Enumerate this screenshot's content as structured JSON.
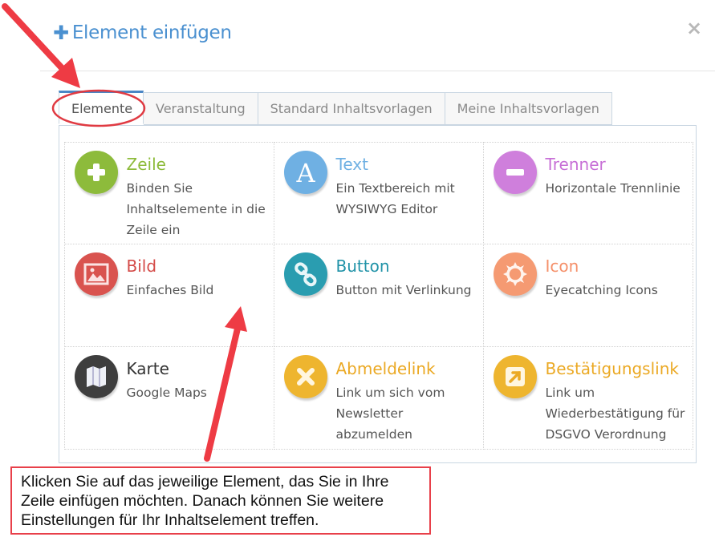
{
  "modal": {
    "title": "Element einfügen",
    "title_icon": "plus-icon",
    "close_icon": "close-icon",
    "close_label": "×"
  },
  "tabs": [
    {
      "label": "Elemente",
      "active": true
    },
    {
      "label": "Veranstaltung",
      "active": false
    },
    {
      "label": "Standard Inhaltsvorlagen",
      "active": false
    },
    {
      "label": "Meine Inhaltsvorlagen",
      "active": false
    }
  ],
  "elements": [
    {
      "title": "Zeile",
      "description": "Binden Sie Inhaltselemente in die Zeile ein",
      "icon": "plus-icon",
      "color": "#8dbb3b",
      "title_color": "#8dbb3b"
    },
    {
      "title": "Text",
      "description": "Ein Textbereich mit WYSIWYG Editor",
      "icon": "letter-a-icon",
      "color": "#6fb0e3",
      "title_color": "#6fb0e3"
    },
    {
      "title": "Trenner",
      "description": "Horizontale Trennlinie",
      "icon": "minus-icon",
      "color": "#cf7fdc",
      "title_color": "#c76fd6"
    },
    {
      "title": "Bild",
      "description": "Einfaches Bild",
      "icon": "image-icon",
      "color": "#d9534f",
      "title_color": "#d44a47"
    },
    {
      "title": "Button",
      "description": "Button mit Verlinkung",
      "icon": "link-icon",
      "color": "#2a9db0",
      "title_color": "#2193a8"
    },
    {
      "title": "Icon",
      "description": "Eyecatching Icons",
      "icon": "sun-icon",
      "color": "#f59a72",
      "title_color": "#f5906a"
    },
    {
      "title": "Karte",
      "description": "Google Maps",
      "icon": "map-icon",
      "color": "#3e3e3e",
      "title_color": "#333333"
    },
    {
      "title": "Abmeldelink",
      "description": "Link um sich vom Newsletter abzumelden",
      "icon": "x-icon",
      "color": "#eeb52f",
      "title_color": "#eba924"
    },
    {
      "title": "Bestätigungslink",
      "description": "Link um Wiederbestätigung für DSGVO Verordnung",
      "icon": "external-link-icon",
      "color": "#eeb52f",
      "title_color": "#eba924"
    }
  ],
  "annotation": {
    "lines": [
      "Klicken Sie auf das jeweilige Element, das Sie in Ihre",
      "Zeile einfügen möchten. Danach können Sie weitere",
      "Einstellungen für Ihr Inhaltselement treffen."
    ],
    "accent_color": "#e8404a"
  }
}
